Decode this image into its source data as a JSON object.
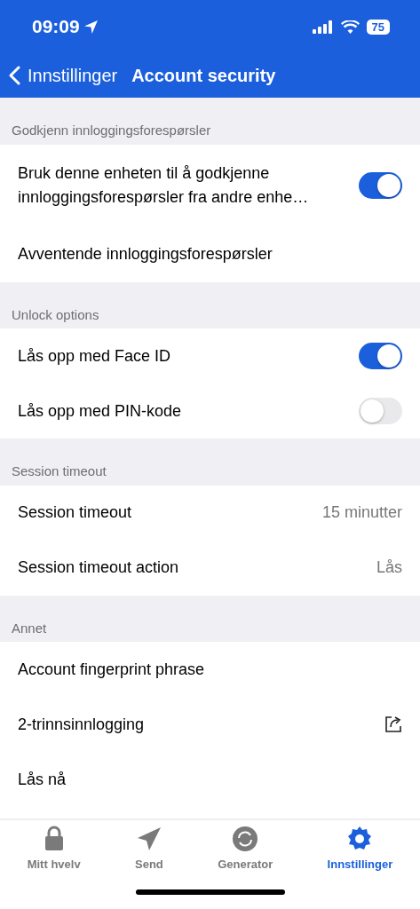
{
  "status_bar": {
    "time": "09:09",
    "battery": "75"
  },
  "nav": {
    "back": "Innstillinger",
    "title": "Account security"
  },
  "sections": [
    {
      "header": "Godkjenn innloggingsforespørsler",
      "rows": [
        {
          "kind": "toggle",
          "label": "Bruk denne enheten til å godkjenne innloggingsforespørsler fra andre enhe…",
          "on": true
        },
        {
          "kind": "plain",
          "label": "Avventende innloggingsforespørsler"
        }
      ]
    },
    {
      "header": "Unlock options",
      "rows": [
        {
          "kind": "toggle",
          "label": "Lås opp med Face ID",
          "on": true
        },
        {
          "kind": "toggle",
          "label": "Lås opp med PIN-kode",
          "on": false
        }
      ]
    },
    {
      "header": "Session timeout",
      "rows": [
        {
          "kind": "value",
          "label": "Session timeout",
          "value": "15 minutter"
        },
        {
          "kind": "value",
          "label": "Session timeout action",
          "value": "Lås"
        }
      ]
    },
    {
      "header": "Annet",
      "rows": [
        {
          "kind": "plain",
          "label": "Account fingerprint phrase"
        },
        {
          "kind": "link",
          "label": "2-trinnsinnlogging"
        },
        {
          "kind": "plain",
          "label": "Lås nå"
        }
      ]
    }
  ],
  "tabs": [
    {
      "kind": "lock",
      "label": "Mitt hvelv",
      "selected": false
    },
    {
      "kind": "send",
      "label": "Send",
      "selected": false
    },
    {
      "kind": "generator",
      "label": "Generator",
      "selected": false
    },
    {
      "kind": "gear",
      "label": "Innstillinger",
      "selected": true
    }
  ]
}
